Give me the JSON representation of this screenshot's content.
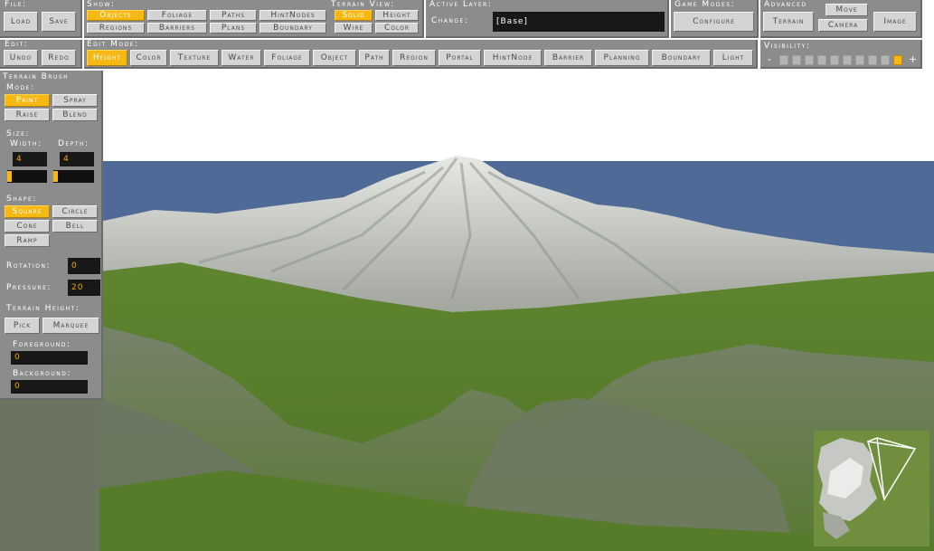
{
  "file": {
    "title": "File:",
    "load": "Load",
    "save": "Save"
  },
  "show": {
    "title": "Show:",
    "objects": "Objects",
    "foliage": "Foliage",
    "paths": "Paths",
    "hintnodes": "HintNodes",
    "regions": "Regions",
    "barriers": "Barriers",
    "plans": "Plans",
    "boundary": "Boundary"
  },
  "terrain_view": {
    "title": "Terrain View:",
    "solid": "Solid",
    "height": "Height",
    "wire": "Wire",
    "color": "Color"
  },
  "active_layer": {
    "title": "Active Layer:",
    "change_label": "Change:",
    "value": "[Base]"
  },
  "game_modes": {
    "title": "Game Modes:",
    "configure": "Configure"
  },
  "advanced": {
    "title": "Advanced",
    "terrain": "Terrain",
    "move": "Move",
    "camera": "Camera",
    "image": "Image"
  },
  "edit": {
    "title": "Edit:",
    "undo": "Undo",
    "redo": "Redo"
  },
  "edit_mode": {
    "title": "Edit Mode:",
    "height": "Height",
    "color": "Color",
    "texture": "Texture",
    "water": "Water",
    "foliage": "Foliage",
    "object": "Object",
    "path": "Path",
    "region": "Region",
    "portal": "Portal",
    "hintnode": "HintNode",
    "barrier": "Barrier",
    "planning": "Planning",
    "boundary": "Boundary",
    "light": "Light"
  },
  "visibility": {
    "title": "Visibility:",
    "minus": "-",
    "plus": "+",
    "level": 10,
    "max": 10
  },
  "brush": {
    "title": "Terrain Brush",
    "mode_label": "Mode:",
    "paint": "Paint",
    "spray": "Spray",
    "raise": "Raise",
    "blend": "Blend",
    "size_label": "Size:",
    "width_label": "Width:",
    "depth_label": "Depth:",
    "width_value": "4",
    "depth_value": "4",
    "shape_label": "Shape:",
    "square": "Square",
    "circle": "Circle",
    "cone": "Cone",
    "bell": "Bell",
    "ramp": "Ramp",
    "rotation_label": "Rotation:",
    "rotation_value": "0",
    "pressure_label": "Pressure:",
    "pressure_value": "20",
    "terrain_height_label": "Terrain Height:",
    "pick": "Pick",
    "marquee": "Marquee",
    "foreground_label": "Foreground:",
    "foreground_value": "0",
    "background_label": "Background:",
    "background_value": "0"
  },
  "colors": {
    "accent": "#f6b914",
    "panel": "#8c8c8c",
    "sky": "#4f6a96",
    "grass": "#5a7f2e"
  }
}
